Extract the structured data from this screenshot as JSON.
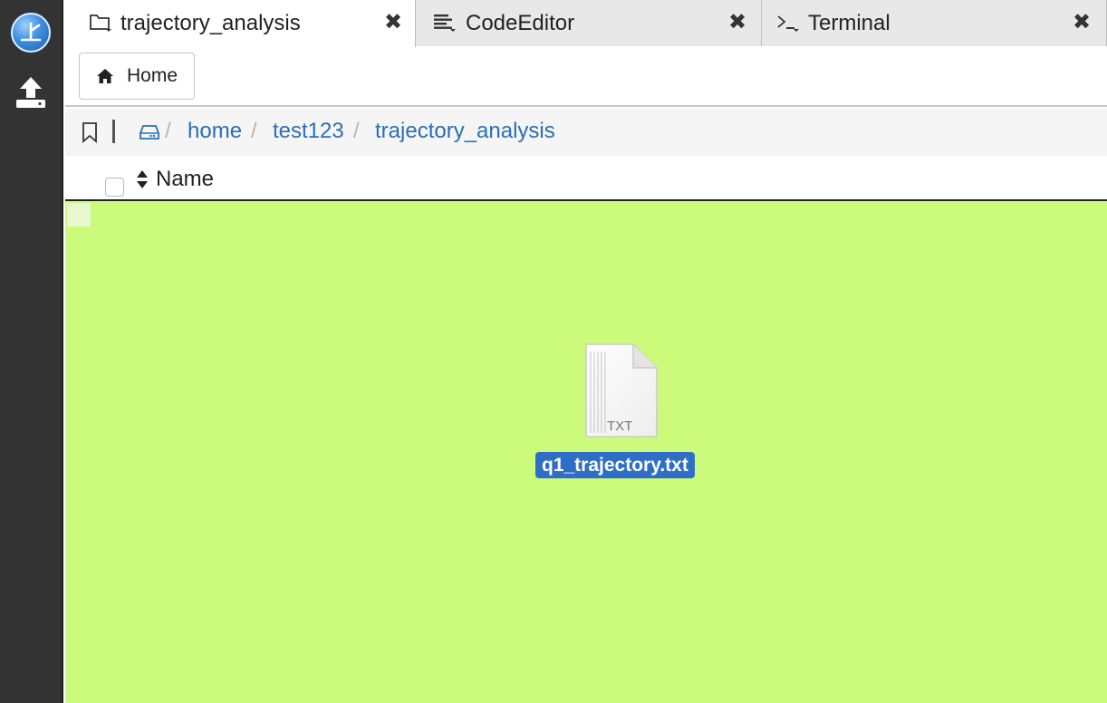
{
  "sidebar": {
    "logo_icon": "app-logo-icon",
    "upload_icon": "upload-icon"
  },
  "tabs": [
    {
      "label": "trajectory_analysis",
      "icon": "folder-icon",
      "active": true
    },
    {
      "label": "CodeEditor",
      "icon": "code-editor-icon",
      "active": false
    },
    {
      "label": "Terminal",
      "icon": "terminal-icon",
      "active": false
    }
  ],
  "tab_close_glyph": "✖",
  "toolbar": {
    "home_label": "Home"
  },
  "breadcrumb": {
    "items": [
      "home",
      "test123",
      "trajectory_analysis"
    ],
    "separator": "/"
  },
  "table": {
    "column_name": "Name"
  },
  "files": [
    {
      "name": "q1_trajectory.txt",
      "type_label": "TXT",
      "selected": true
    }
  ],
  "colors": {
    "file_area_bg": "#ccfb7c",
    "selection": "#2f6ec7",
    "link": "#2a6fb6",
    "sidebar": "#333333"
  }
}
